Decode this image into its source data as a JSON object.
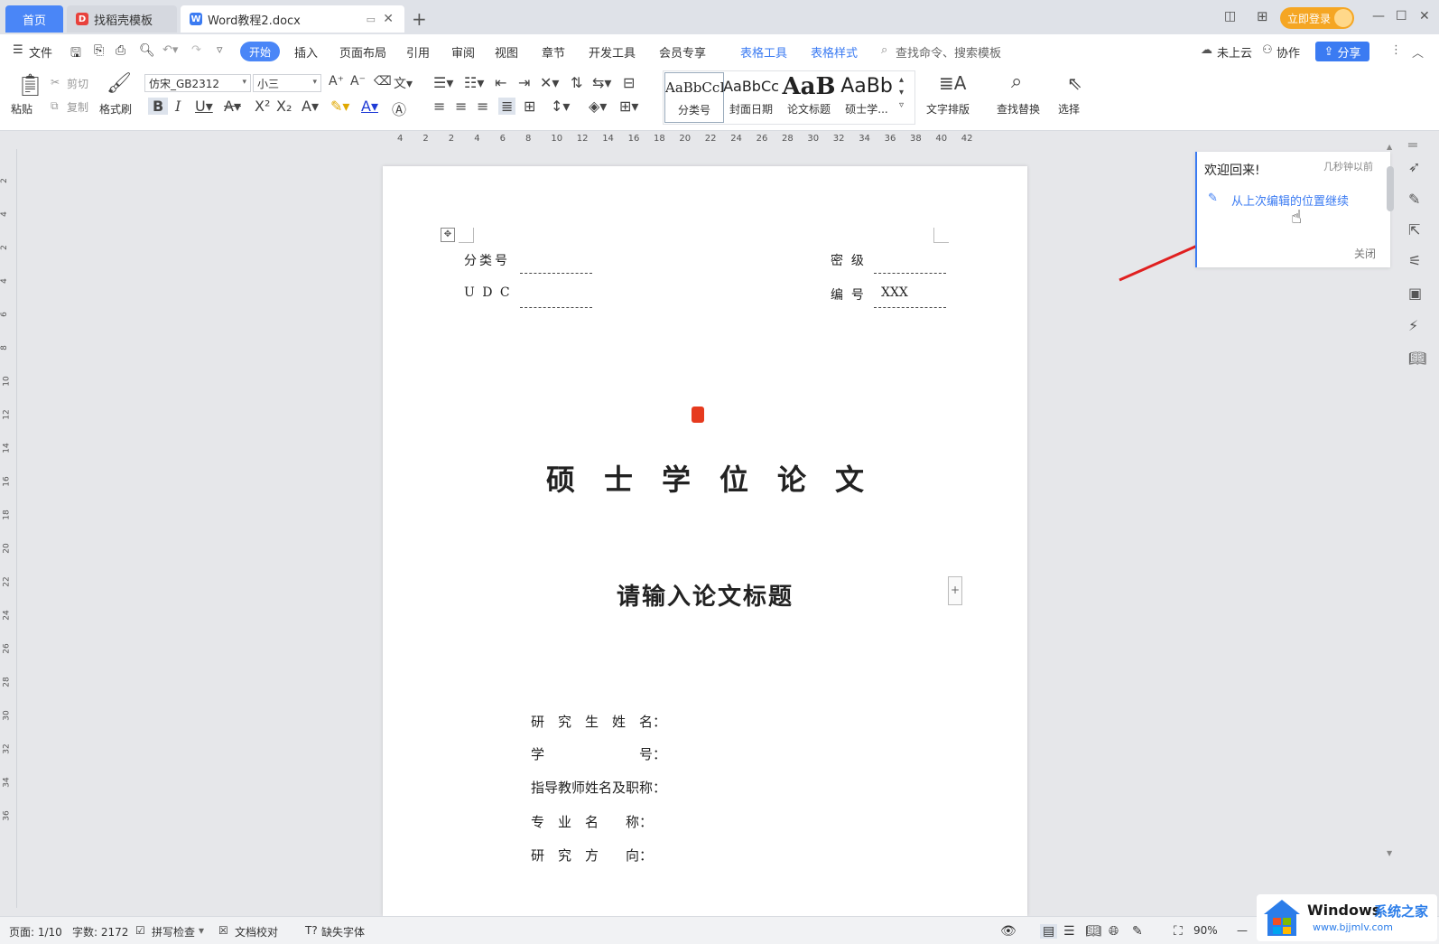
{
  "colors": {
    "accent": "#3b7bf2",
    "login": "#f5a623",
    "arrow": "#e02020"
  },
  "tabs": {
    "home": "首页",
    "template": "找稻壳模板",
    "doc": "Word教程2.docx"
  },
  "titlebar": {
    "login": "立即登录"
  },
  "menu": {
    "file": "文件",
    "items": [
      "开始",
      "插入",
      "页面布局",
      "引用",
      "审阅",
      "视图",
      "章节",
      "开发工具",
      "会员专享"
    ],
    "table_tools": "表格工具",
    "table_style": "表格样式",
    "search_placeholder": "查找命令、搜索模板",
    "cloud": "未上云",
    "collab": "协作",
    "share": "分享"
  },
  "toolbar": {
    "paste": "粘贴",
    "cut": "剪切",
    "copy": "复制",
    "format_painter": "格式刷",
    "font": "仿宋_GB2312",
    "size": "小三",
    "styles": [
      {
        "preview": "AaBbCcI",
        "name": "分类号"
      },
      {
        "preview": "AaBbCc",
        "name": "封面日期"
      },
      {
        "preview": "AaB",
        "name": "论文标题"
      },
      {
        "preview": "AaBb",
        "name": "硕士学..."
      }
    ],
    "text_layout": "文字排版",
    "find_replace": "查找替换",
    "select": "选择"
  },
  "ruler": {
    "ticks": [
      "4",
      "2",
      "2",
      "4",
      "6",
      "8",
      "10",
      "12",
      "14",
      "16",
      "18",
      "20",
      "22",
      "24",
      "26",
      "28",
      "30",
      "32",
      "34",
      "36",
      "38",
      "40",
      "42"
    ],
    "vticks": [
      "2",
      "4",
      "2",
      "4",
      "6",
      "8",
      "10",
      "12",
      "14",
      "16",
      "18",
      "20",
      "22",
      "24",
      "26",
      "28",
      "30",
      "32",
      "34",
      "36"
    ]
  },
  "document": {
    "class_no_label": "分类号",
    "udc_label": "U D C",
    "secret_label": "密  级",
    "number_label": "编  号",
    "number_value": "XXX",
    "thesis_type": "硕　士　学　位　论　文",
    "title": "请输入论文标题",
    "fields": [
      "研　究　生　姓　名：",
      "学　　　　　　　号：",
      "指导教师姓名及职称：",
      "专　业　名　　称：",
      "研　究　方　　向："
    ]
  },
  "welcome_panel": {
    "greeting": "欢迎回来!",
    "time": "几秒钟以前",
    "continue": "从上次编辑的位置继续",
    "close": "关闭"
  },
  "status": {
    "page": "页面: 1/10",
    "words": "字数: 2172",
    "spell": "拼写检查",
    "proof": "文档校对",
    "missing_font": "缺失字体",
    "zoom": "90%"
  },
  "watermark": {
    "brand": "Windows",
    "cn": "系统之家",
    "url": "www.bjjmlv.com"
  }
}
